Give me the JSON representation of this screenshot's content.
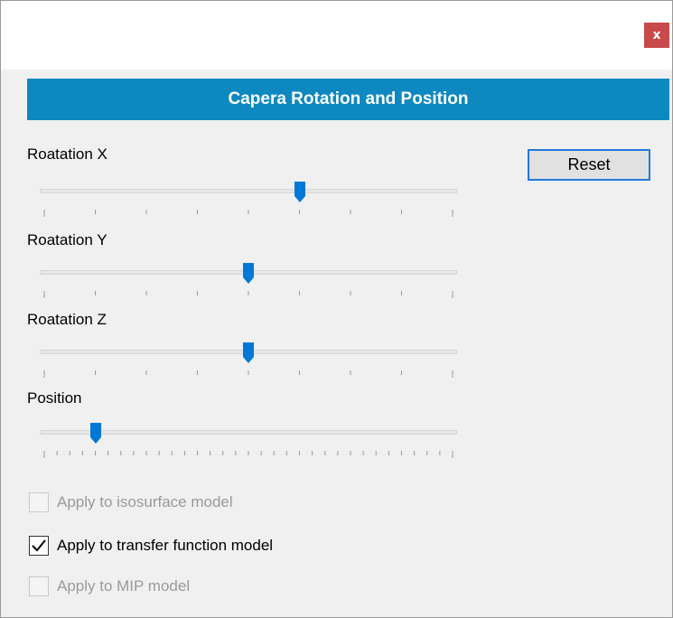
{
  "window": {
    "close_glyph": "x",
    "close_color": "#c84a4a"
  },
  "header": {
    "title": "Capera Rotation and Position",
    "color": "#0e88c0"
  },
  "reset_label": "Reset",
  "sliders": [
    {
      "label": "Roatation X",
      "value_fraction": 0.625,
      "tick_count": 9
    },
    {
      "label": "Roatation Y",
      "value_fraction": 0.5,
      "tick_count": 9
    },
    {
      "label": "Roatation Z",
      "value_fraction": 0.5,
      "tick_count": 9
    },
    {
      "label": "Position",
      "value_fraction": 0.125,
      "tick_count": 33
    }
  ],
  "checkboxes": [
    {
      "label": "Apply to isosurface model",
      "checked": false,
      "enabled": false
    },
    {
      "label": "Apply to transfer function model",
      "checked": true,
      "enabled": true
    },
    {
      "label": "Apply to MIP model",
      "checked": false,
      "enabled": false
    }
  ],
  "accent_color": "#0078d7"
}
